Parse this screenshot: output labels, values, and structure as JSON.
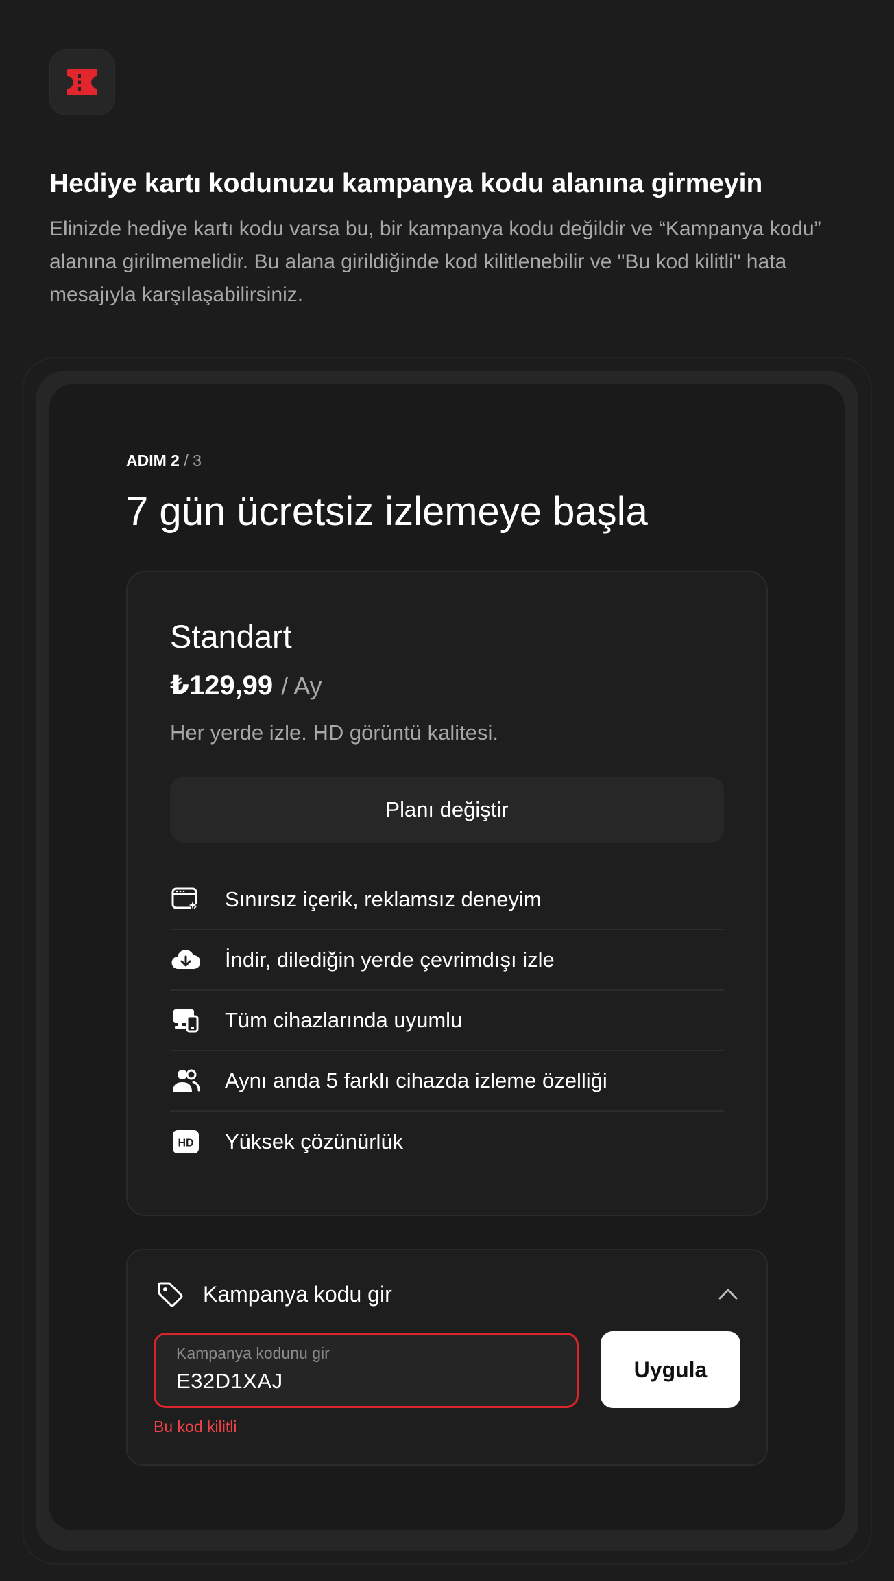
{
  "intro": {
    "title": "Hediye kartı kodunuzu kampanya kodu alanına girmeyin",
    "description": "Elinizde hediye kartı kodu varsa bu, bir kampanya kodu değildir ve “Kampanya kodu” alanına girilmemelidir. Bu alana girildiğinde kod kilitlenebilir ve \"Bu kod kilitli\" hata mesajıyla karşılaşabilirsiniz."
  },
  "step": {
    "label": "ADIM 2",
    "total": " / 3"
  },
  "heading": "7 gün ücretsiz izlemeye başla",
  "plan": {
    "name": "Standart",
    "price": "₺129,99",
    "period": "/ Ay",
    "description": "Her yerde izle. HD görüntü kalitesi.",
    "change_label": "Planı değiştir",
    "features": [
      {
        "icon": "sparkle-window-icon",
        "text": "Sınırsız içerik, reklamsız deneyim"
      },
      {
        "icon": "cloud-download-icon",
        "text": "İndir, dilediğin yerde çevrimdışı izle"
      },
      {
        "icon": "devices-icon",
        "text": "Tüm cihazlarında uyumlu"
      },
      {
        "icon": "users-icon",
        "text": "Aynı anda 5 farklı cihazda izleme özelliği"
      },
      {
        "icon": "hd-icon",
        "text": "Yüksek çözünürlük"
      }
    ],
    "hd_badge": "HD"
  },
  "promo": {
    "title": "Kampanya kodu gir",
    "input_label": "Kampanya kodunu gir",
    "input_value": "E32D1XAJ",
    "apply_label": "Uygula",
    "error": "Bu kod kilitli"
  },
  "colors": {
    "background": "#1c1c1c",
    "accent_red": "#e3262d",
    "error_red": "#ef4148",
    "text_muted": "#a8a8a8"
  }
}
